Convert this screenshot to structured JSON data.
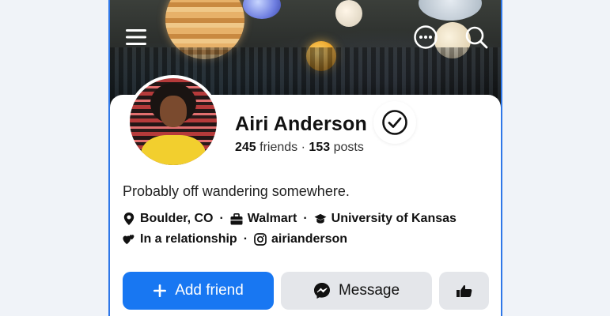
{
  "profile": {
    "name": "Airi Anderson",
    "friends_count": "245",
    "friends_label": "friends",
    "separator": "·",
    "posts_count": "153",
    "posts_label": "posts",
    "bio": "Probably off wandering somewhere.",
    "location": "Boulder, CO",
    "work": "Walmart",
    "education": "University of Kansas",
    "relationship": "In a relationship",
    "instagram": "airianderson"
  },
  "actions": {
    "add_friend_label": "Add friend",
    "message_label": "Message"
  },
  "icons": {
    "menu": "hamburger-menu-icon",
    "more": "more-options-icon",
    "search": "search-icon",
    "verified": "verified-check-icon",
    "location": "map-pin-icon",
    "work": "briefcase-icon",
    "education": "graduation-cap-icon",
    "relationship": "hearts-icon",
    "instagram": "instagram-icon",
    "add": "plus-icon",
    "messenger": "messenger-icon",
    "reaction": "pointing-hand-icon"
  },
  "colors": {
    "primary": "#1877f2",
    "secondary_button": "#e4e6ea",
    "frame_border": "#2f77e8"
  }
}
